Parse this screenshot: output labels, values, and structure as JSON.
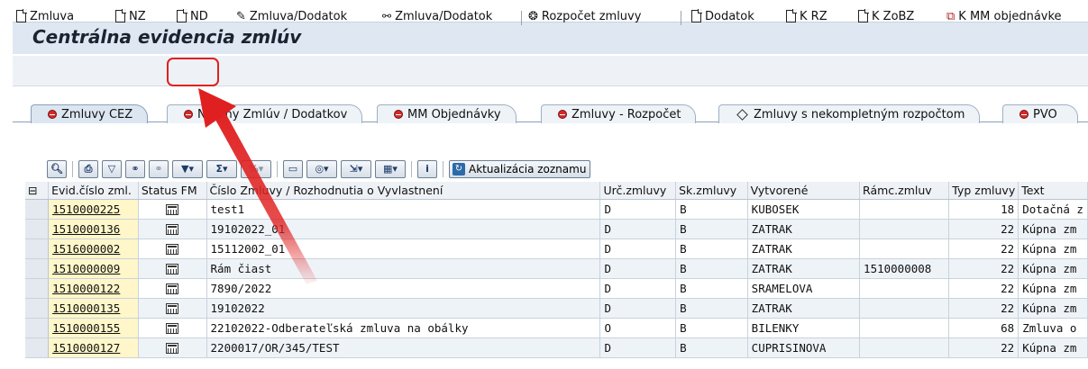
{
  "window": {
    "title": "Centrálna evidencia zmlúv"
  },
  "toolbar": {
    "items": [
      {
        "label": "Zmluva",
        "icon": "new-document-icon"
      },
      {
        "label": "NZ",
        "icon": "new-document-icon"
      },
      {
        "label": "ND",
        "icon": "new-document-icon"
      },
      {
        "label": "Zmluva/Dodatok",
        "icon": "pencil-icon"
      },
      {
        "label": "Zmluva/Dodatok",
        "icon": "glasses-icon"
      },
      {
        "label": "Rozpočet zmluvy",
        "icon": "budget-icon"
      },
      {
        "label": "Dodatok",
        "icon": "new-document-icon"
      },
      {
        "label": "K RZ",
        "icon": "new-document-icon"
      },
      {
        "label": "K ZoBZ",
        "icon": "new-document-icon"
      },
      {
        "label": "K MM objednávke",
        "icon": "copy-document-icon"
      }
    ]
  },
  "tabs": [
    {
      "label": "Zmluvy CEZ",
      "icon": "red-dot-icon",
      "active": true
    },
    {
      "label": "Návrhy Zmlúv / Dodatkov",
      "icon": "red-dot-icon"
    },
    {
      "label": "MM Objednávky",
      "icon": "red-dot-icon"
    },
    {
      "label": "Zmluvy - Rozpočet",
      "icon": "red-dot-icon"
    },
    {
      "label": "Zmluvy s nekompletným rozpočtom",
      "icon": "diamond-icon"
    },
    {
      "label": "PVO",
      "icon": "red-dot-icon"
    }
  ],
  "alv_toolbar": {
    "refresh_label": "Aktualizácia zoznamu"
  },
  "table": {
    "columns": [
      "Evid.číslo zml.",
      "Status FM",
      "Číslo Zmluvy / Rozhodnutia o Vyvlastnení",
      "Urč.zmluvy",
      "Sk.zmluvy",
      "Vytvorené",
      "Rámc.zmluv",
      "Typ zmluvy",
      "Text"
    ],
    "rows": [
      {
        "evid": "1510000225",
        "cislo": "test1",
        "urc": "D",
        "sk": "B",
        "vytvorene": "KUBOSEK",
        "ramc": "",
        "typ": "18",
        "text": "Dotačná z"
      },
      {
        "evid": "1510000136",
        "cislo": "19102022_01",
        "urc": "D",
        "sk": "B",
        "vytvorene": "ZATRAK",
        "ramc": "",
        "typ": "22",
        "text": "Kúpna zm"
      },
      {
        "evid": "1516000002",
        "cislo": "15112002_01",
        "urc": "D",
        "sk": "B",
        "vytvorene": "ZATRAK",
        "ramc": "",
        "typ": "22",
        "text": "Kúpna zm"
      },
      {
        "evid": "1510000009",
        "cislo": "Rám čiast",
        "urc": "D",
        "sk": "B",
        "vytvorene": "ZATRAK",
        "ramc": "1510000008",
        "typ": "22",
        "text": "Kúpna zm"
      },
      {
        "evid": "1510000122",
        "cislo": "7890/2022",
        "urc": "D",
        "sk": "B",
        "vytvorene": "SRAMELOVA",
        "ramc": "",
        "typ": "22",
        "text": "Kúpna zm"
      },
      {
        "evid": "1510000135",
        "cislo": "19102022",
        "urc": "D",
        "sk": "B",
        "vytvorene": "ZATRAK",
        "ramc": "",
        "typ": "22",
        "text": "Kúpna zm"
      },
      {
        "evid": "1510000155",
        "cislo": "22102022-Odberateľská zmluva na obálky",
        "urc": "O",
        "sk": "B",
        "vytvorene": "BILENKY",
        "ramc": "",
        "typ": "68",
        "text": "Zmluva o"
      },
      {
        "evid": "1510000127",
        "cislo": "2200017/OR/345/TEST",
        "urc": "D",
        "sk": "B",
        "vytvorene": "CUPRISINOVA",
        "ramc": "",
        "typ": "22",
        "text": "Kúpna zm"
      }
    ]
  },
  "annotation": {
    "color": "#e02020"
  }
}
